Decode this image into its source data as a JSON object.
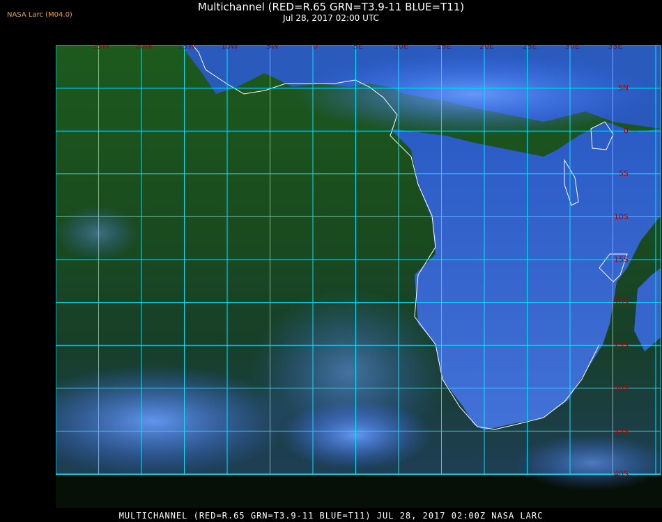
{
  "header": {
    "title": "Multichannel (RED=R.65 GRN=T3.9-11 BLUE=T11)",
    "subtitle": "Jul 28, 2017 02:00 UTC",
    "credit": "NASA Larc (M04.0)"
  },
  "map": {
    "lon_labels": [
      "25W",
      "20W",
      "15W",
      "10W",
      "5W",
      "0",
      "5E",
      "10E",
      "15E",
      "20E",
      "25E",
      "30E",
      "35E"
    ],
    "lat_labels": [
      "5N",
      "0",
      "5S",
      "10S",
      "15S",
      "20S",
      "25S",
      "30S",
      "35S",
      "40S"
    ],
    "colors": {
      "grid": "#00e5ff",
      "label": "#b30000",
      "ocean": "#1a4a1a",
      "cloud": "#3a6bff",
      "land": "#3d62d6",
      "coast": "#ffffff"
    }
  },
  "footer": {
    "text": "MULTICHANNEL (RED=R.65 GRN=T3.9-11 BLUE=T11) JUL 28, 2017 02:00Z   NASA LARC"
  }
}
